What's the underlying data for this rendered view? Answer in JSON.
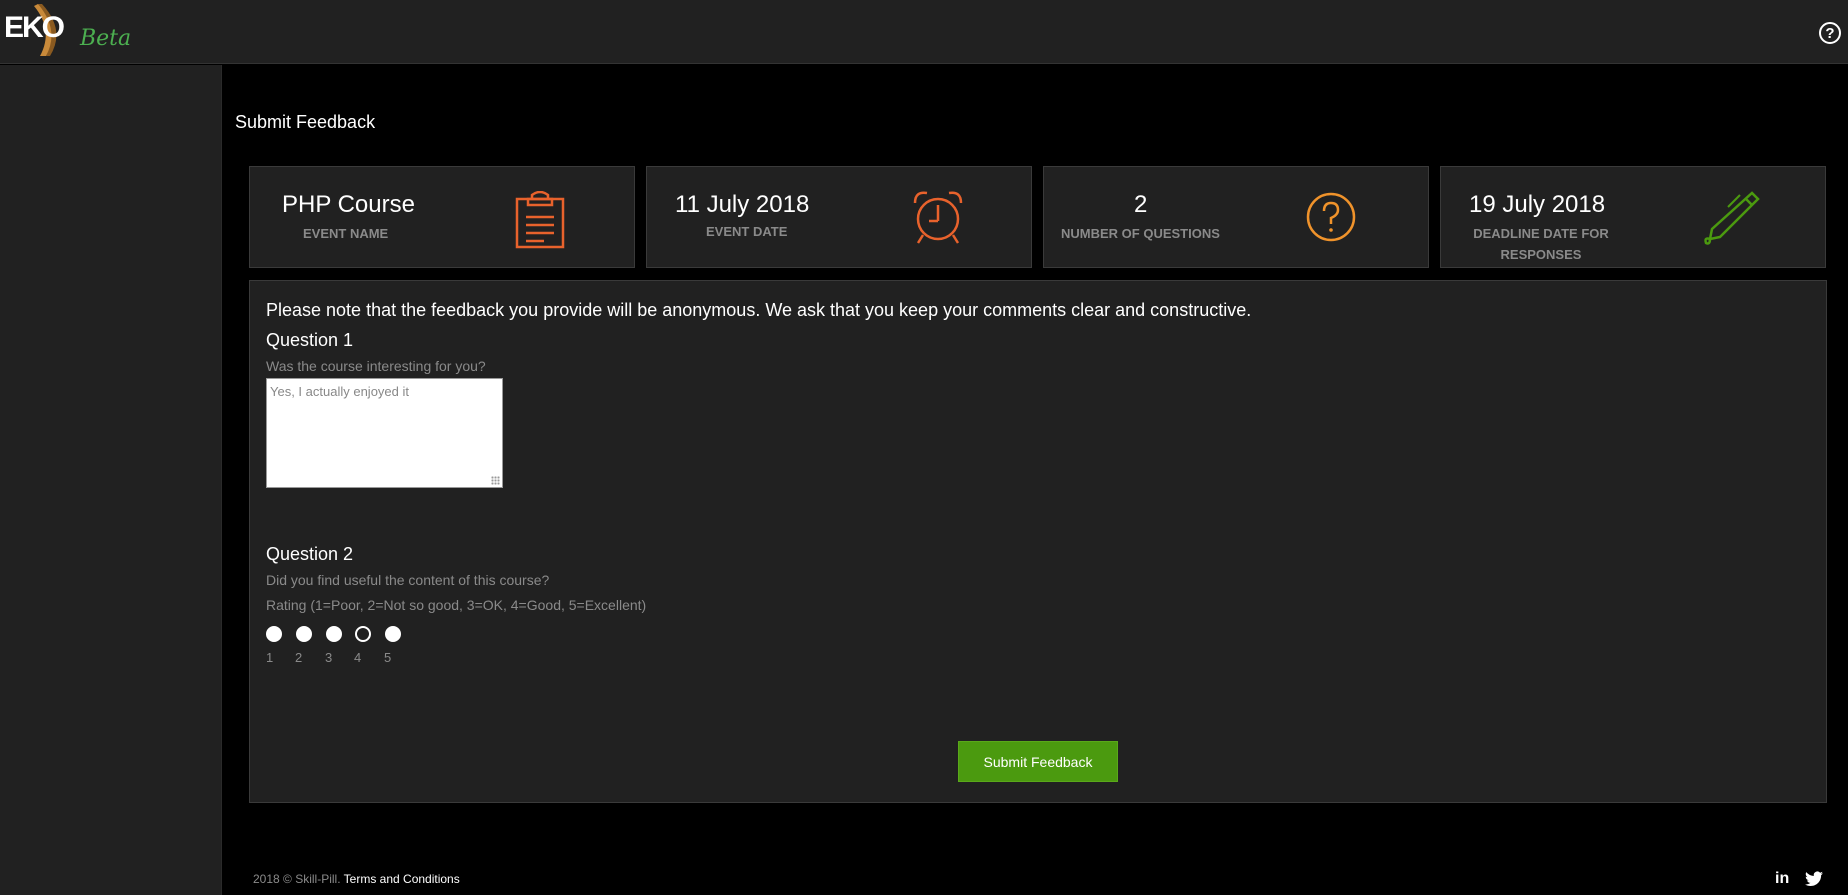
{
  "app": {
    "logo_text": "EKO",
    "badge": "Beta",
    "help_icon": "help-circle-icon"
  },
  "page": {
    "title": "Submit Feedback"
  },
  "cards": [
    {
      "value": "PHP Course",
      "label": "EVENT NAME",
      "icon": "clipboard-icon",
      "icon_color": "#e8622c"
    },
    {
      "value": "11 July 2018",
      "label": "EVENT DATE",
      "icon": "alarm-clock-icon",
      "icon_color": "#e8622c"
    },
    {
      "value": "2",
      "label": "NUMBER OF QUESTIONS",
      "icon": "question-circle-icon",
      "icon_color": "#f0932b"
    },
    {
      "value": "19 July 2018",
      "label_line1": "DEADLINE DATE FOR",
      "label_line2": "RESPONSES",
      "icon": "pen-icon",
      "icon_color": "#4b9a0f"
    }
  ],
  "form": {
    "note": "Please note that the feedback you provide will be anonymous. We ask that you keep your comments clear and constructive.",
    "q1": {
      "title": "Question 1",
      "text": "Was the course interesting for you?",
      "answer": "Yes, I actually enjoyed it"
    },
    "q2": {
      "title": "Question 2",
      "text": "Did you find useful the content of this course?",
      "scale": "Rating (1=Poor, 2=Not so good, 3=OK, 4=Good, 5=Excellent)",
      "options": [
        "1",
        "2",
        "3",
        "4",
        "5"
      ]
    },
    "submit_label": "Submit Feedback"
  },
  "footer": {
    "copyright": "2018 © Skill-Pill.",
    "terms": "Terms and Conditions",
    "social": [
      "linkedin-icon",
      "twitter-icon"
    ],
    "linkedin_text": "in"
  },
  "colors": {
    "accent_green": "#4b9a0f",
    "accent_orange": "#e8622c",
    "panel_bg": "#212121"
  }
}
